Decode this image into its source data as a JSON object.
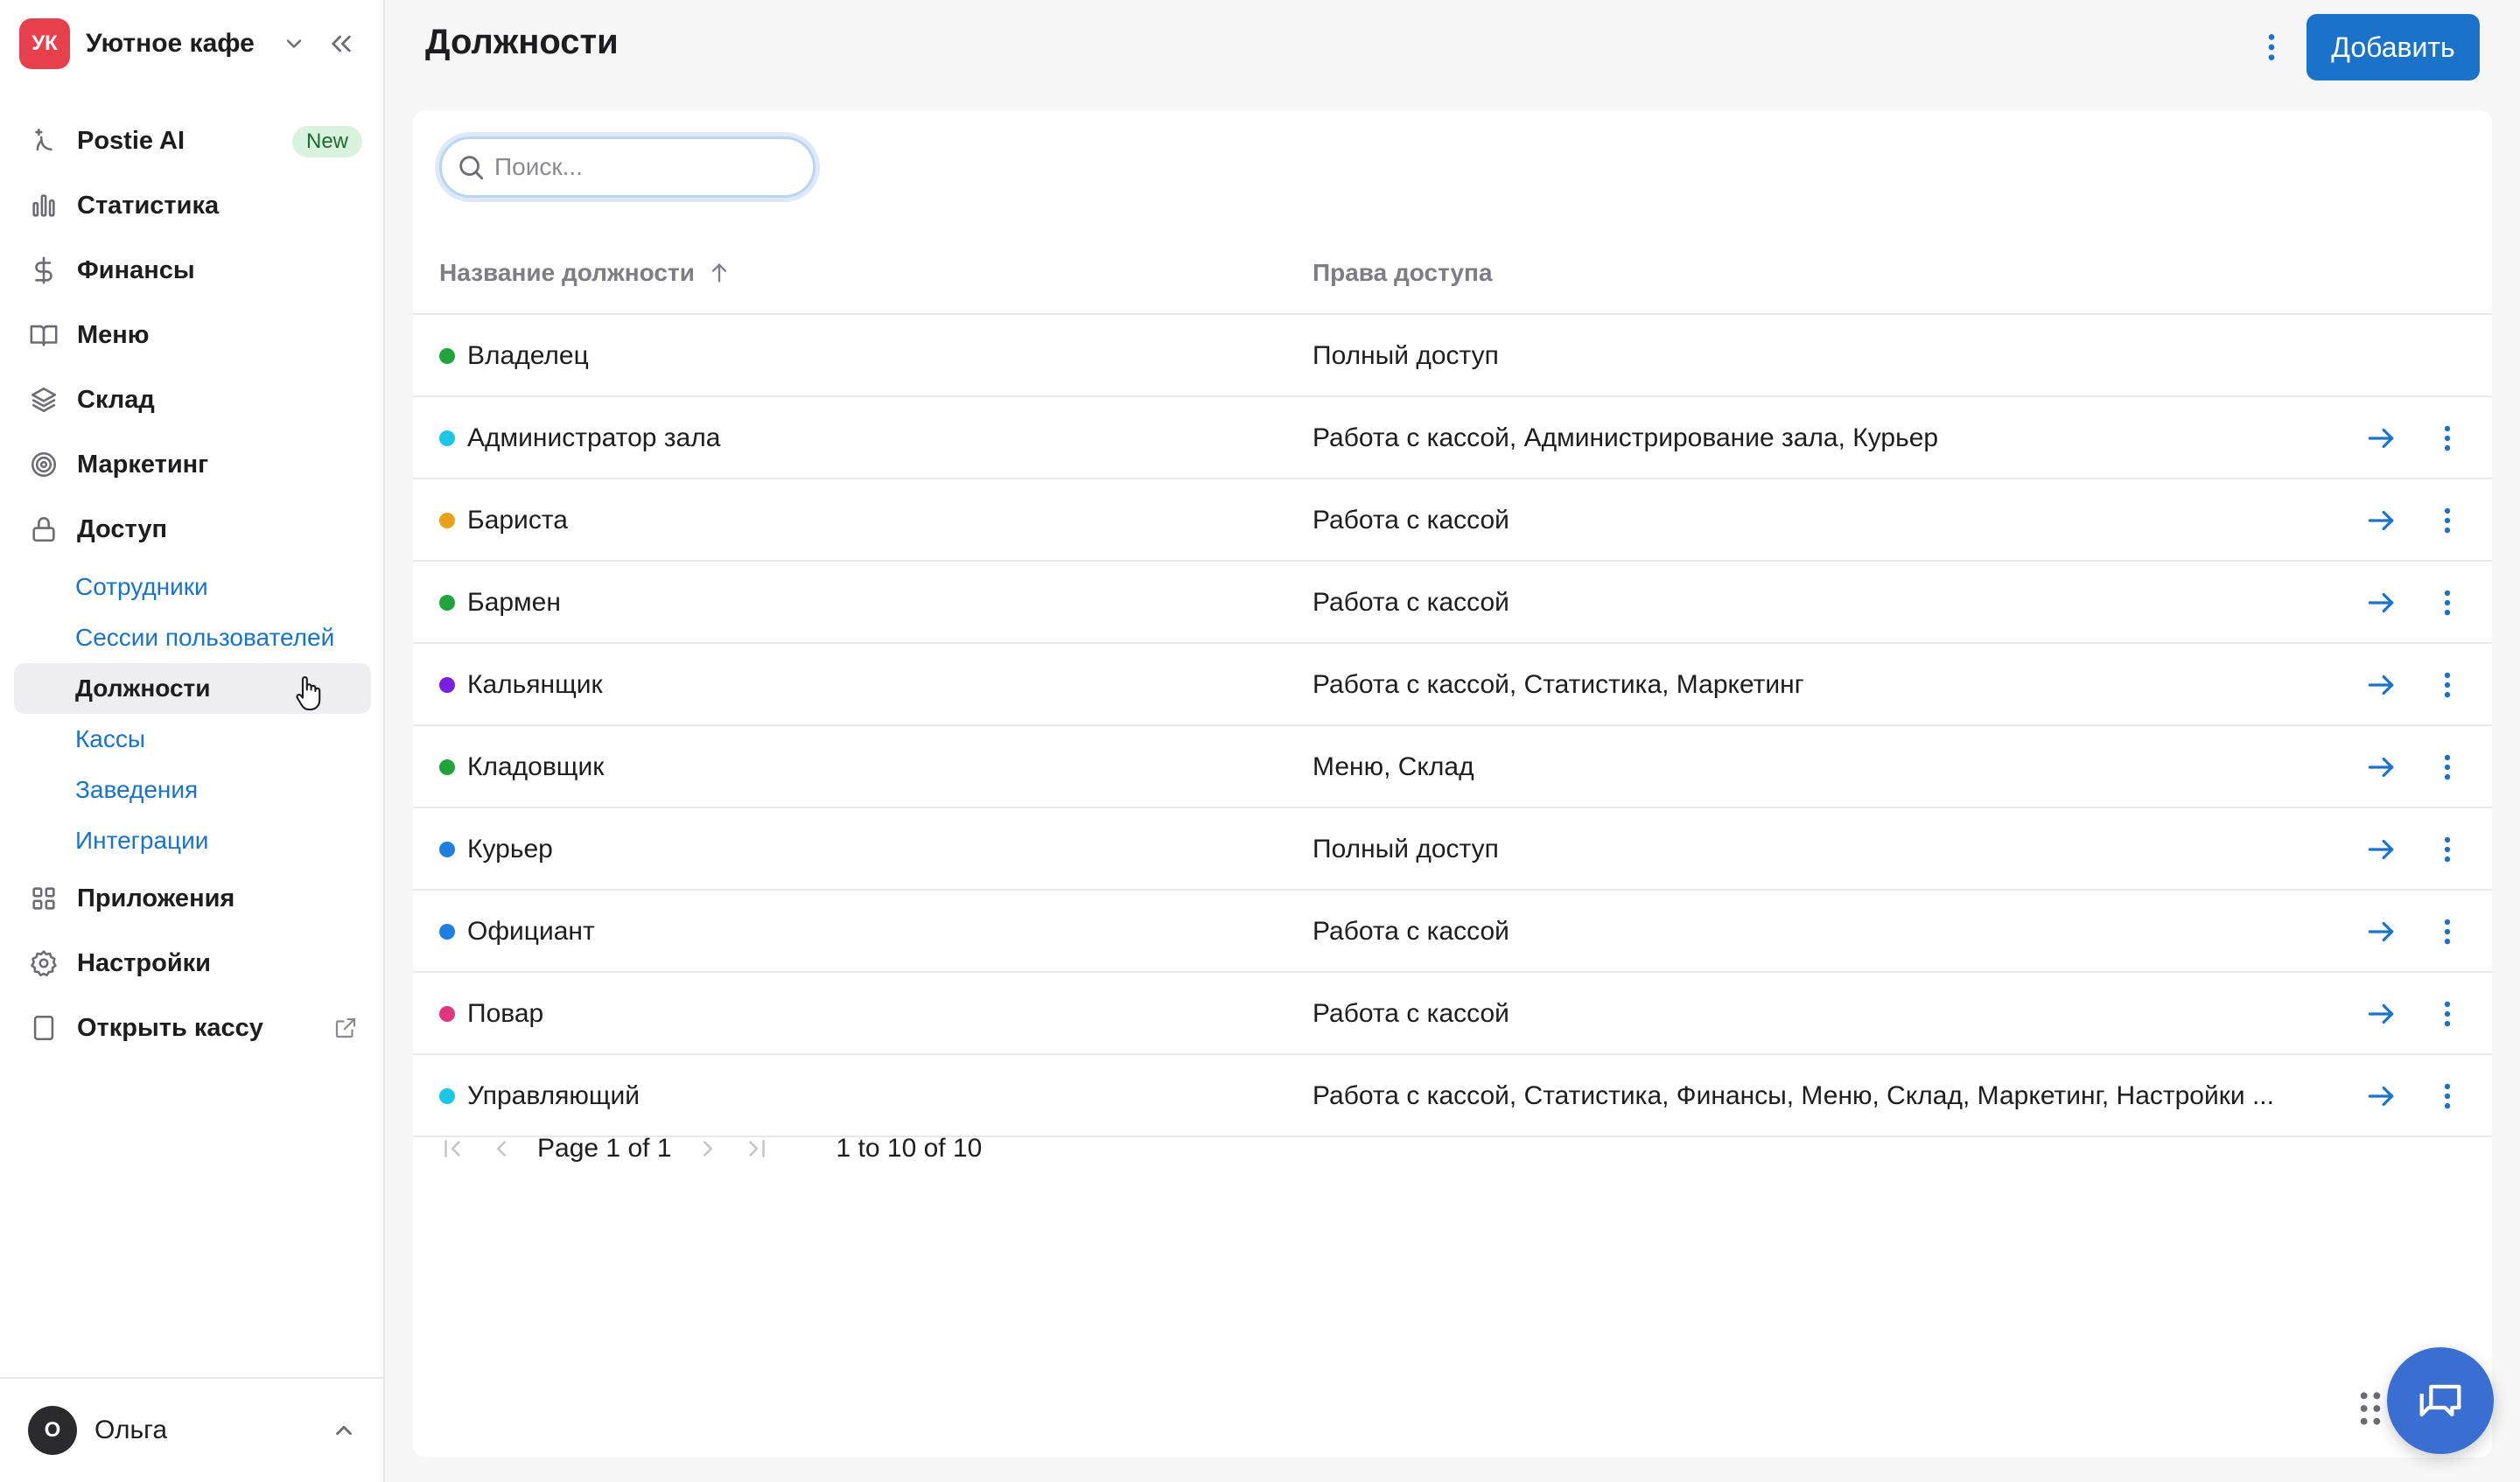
{
  "brand": {
    "initials": "УК",
    "name": "Уютное кафе",
    "badge_color": "#e5404b"
  },
  "nav": {
    "items": [
      {
        "key": "postie",
        "label": "Postie AI",
        "icon": "sparkle-icon",
        "badge": "New"
      },
      {
        "key": "stats",
        "label": "Статистика",
        "icon": "bar-chart-icon"
      },
      {
        "key": "finance",
        "label": "Финансы",
        "icon": "dollar-icon"
      },
      {
        "key": "menu",
        "label": "Меню",
        "icon": "book-icon"
      },
      {
        "key": "warehouse",
        "label": "Склад",
        "icon": "layers-icon"
      },
      {
        "key": "marketing",
        "label": "Маркетинг",
        "icon": "target-icon"
      },
      {
        "key": "access",
        "label": "Доступ",
        "icon": "lock-icon"
      }
    ],
    "access_sub": [
      {
        "label": "Сотрудники",
        "active": false
      },
      {
        "label": "Сессии пользователей",
        "active": false
      },
      {
        "label": "Должности",
        "active": true
      },
      {
        "label": "Кассы",
        "active": false
      },
      {
        "label": "Заведения",
        "active": false
      },
      {
        "label": "Интеграции",
        "active": false
      }
    ],
    "bottom_items": [
      {
        "key": "apps",
        "label": "Приложения",
        "icon": "grid-icon"
      },
      {
        "key": "settings",
        "label": "Настройки",
        "icon": "gear-icon"
      },
      {
        "key": "pos",
        "label": "Открыть кассу",
        "icon": "tablet-icon",
        "external": true
      }
    ]
  },
  "user": {
    "initial": "О",
    "name": "Ольга"
  },
  "header": {
    "title": "Должности",
    "add_label": "Добавить"
  },
  "search": {
    "placeholder": "Поиск...",
    "value": ""
  },
  "table": {
    "columns": {
      "name": "Название должности",
      "rights": "Права доступа"
    },
    "rows": [
      {
        "name": "Владелец",
        "rights": "Полный доступ",
        "color": "#1fa33a",
        "actions": false
      },
      {
        "name": "Администратор зала",
        "rights": "Работа с кассой, Администрирование зала, Курьер",
        "color": "#1ec6e6",
        "actions": true
      },
      {
        "name": "Бариста",
        "rights": "Работа с кассой",
        "color": "#e8a218",
        "actions": true
      },
      {
        "name": "Бармен",
        "rights": "Работа с кассой",
        "color": "#1fa33a",
        "actions": true
      },
      {
        "name": "Кальянщик",
        "rights": "Работа с кассой, Статистика, Маркетинг",
        "color": "#7a1fe0",
        "actions": true
      },
      {
        "name": "Кладовщик",
        "rights": "Меню, Склад",
        "color": "#1fa33a",
        "actions": true
      },
      {
        "name": "Курьер",
        "rights": "Полный доступ",
        "color": "#1f7fe0",
        "actions": true
      },
      {
        "name": "Официант",
        "rights": "Работа с кассой",
        "color": "#1f7fe0",
        "actions": true
      },
      {
        "name": "Повар",
        "rights": "Работа с кассой",
        "color": "#e0357f",
        "actions": true
      },
      {
        "name": "Управляющий",
        "rights": "Работа с кассой, Статистика, Финансы, Меню, Склад, Маркетинг, Настройки ...",
        "color": "#1ec6e6",
        "actions": true
      }
    ]
  },
  "pagination": {
    "page_text_prefix": "Page",
    "page_current": "1",
    "page_of": "of",
    "page_total": "1",
    "range": "1 to 10 of 10"
  },
  "colors": {
    "accent": "#1a73c8",
    "chat": "#3a6fd1"
  }
}
